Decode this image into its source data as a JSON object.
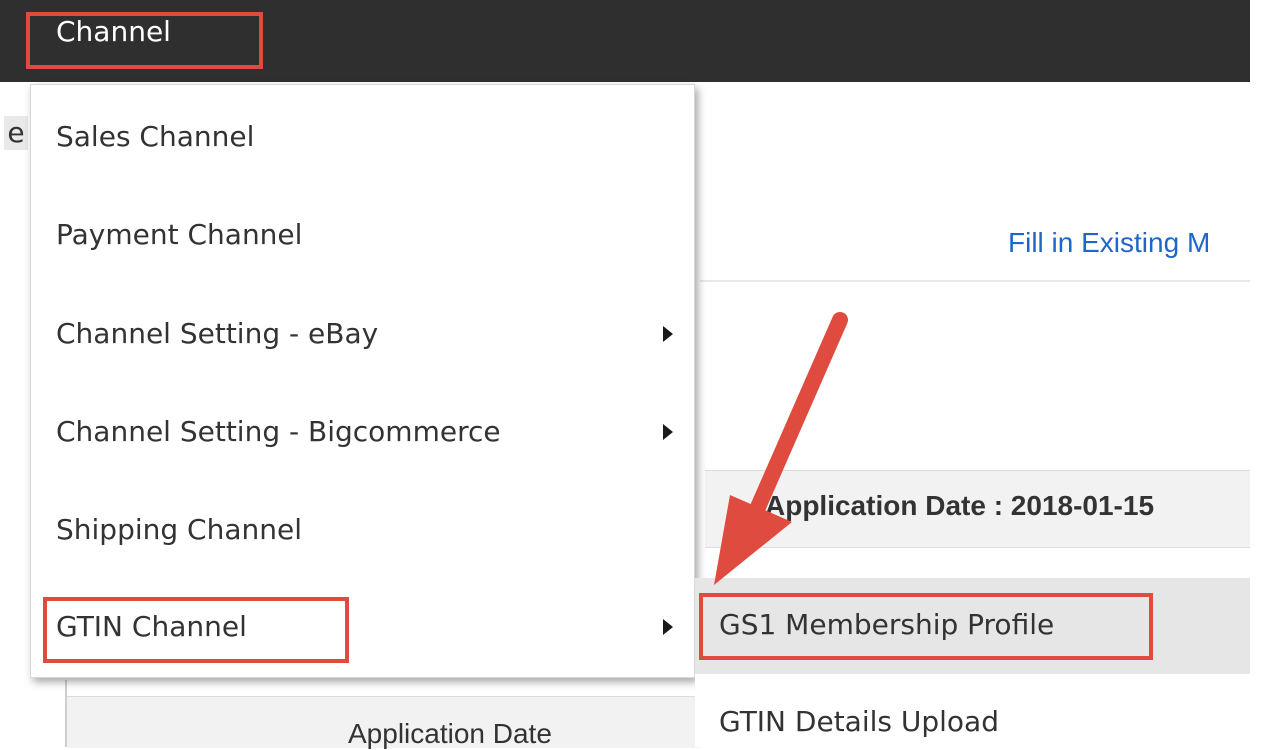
{
  "nav": {
    "channel_label": "Channel"
  },
  "page": {
    "fragment_letter": "e",
    "fill_link": "Fill in Existing M",
    "application_date_label": "Application Date : 2018-01-15",
    "table_header_application_date": "Application Date"
  },
  "menu": {
    "items": [
      {
        "label": "Sales Channel",
        "has_submenu": false
      },
      {
        "label": "Payment Channel",
        "has_submenu": false
      },
      {
        "label": "Channel Setting - eBay",
        "has_submenu": true
      },
      {
        "label": "Channel Setting - Bigcommerce",
        "has_submenu": true
      },
      {
        "label": "Shipping Channel",
        "has_submenu": false
      },
      {
        "label": "GTIN Channel",
        "has_submenu": true
      }
    ]
  },
  "submenu": {
    "items": [
      {
        "label": "GS1 Membership Profile"
      },
      {
        "label": "GTIN Details Upload"
      }
    ]
  },
  "colors": {
    "highlight_red": "#e04b3f",
    "topbar": "#2f2f2f",
    "link_blue": "#1f66c9"
  }
}
